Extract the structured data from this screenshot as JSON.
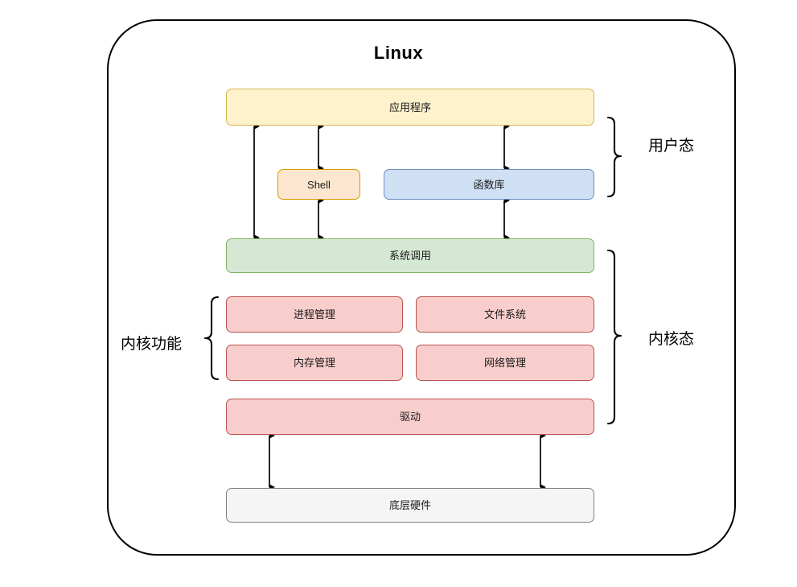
{
  "diagram": {
    "title": "Linux",
    "type": "architecture-layer-diagram"
  },
  "nodes": {
    "application": {
      "label": "应用程序",
      "fill": "#fdf2cc",
      "stroke": "#d6b656"
    },
    "shell": {
      "label": "Shell",
      "fill": "#fde6cf",
      "stroke": "#d79b00"
    },
    "libraries": {
      "label": "函数库",
      "fill": "#cfdff4",
      "stroke": "#6c8ebf"
    },
    "system_call": {
      "label": "系统调用",
      "fill": "#d5e8d4",
      "stroke": "#82b366"
    },
    "process_mgmt": {
      "label": "进程管理",
      "fill": "#f8cecc",
      "stroke": "#b85450"
    },
    "file_system": {
      "label": "文件系统",
      "fill": "#f8cecc",
      "stroke": "#b85450"
    },
    "memory_mgmt": {
      "label": "内存管理",
      "fill": "#f8cecc",
      "stroke": "#b85450"
    },
    "network_mgmt": {
      "label": "网络管理",
      "fill": "#f8cecc",
      "stroke": "#b85450"
    },
    "driver": {
      "label": "驱动",
      "fill": "#f8cecc",
      "stroke": "#b85450"
    },
    "hardware": {
      "label": "底层硬件",
      "fill": "#f5f5f5",
      "stroke": "#808080"
    }
  },
  "annotations": {
    "user_mode": "用户态",
    "kernel_mode": "内核态",
    "kernel_functions": "内核功能"
  },
  "chart_data": {
    "type": "diagram",
    "title": "Linux",
    "layers": [
      {
        "name": "应用程序",
        "tier": "用户态",
        "children": [
          "Shell",
          "函数库"
        ]
      },
      {
        "name": "系统调用",
        "tier": "boundary"
      },
      {
        "name": "内核功能",
        "tier": "内核态",
        "children": [
          "进程管理",
          "文件系统",
          "内存管理",
          "网络管理"
        ]
      },
      {
        "name": "驱动",
        "tier": "内核态"
      },
      {
        "name": "底层硬件",
        "tier": "hardware"
      }
    ],
    "connections": [
      {
        "from": "应用程序",
        "to": "系统调用",
        "kind": "bidirectional"
      },
      {
        "from": "应用程序",
        "to": "Shell",
        "kind": "bidirectional"
      },
      {
        "from": "Shell",
        "to": "系统调用",
        "kind": "bidirectional"
      },
      {
        "from": "应用程序",
        "to": "函数库",
        "kind": "bidirectional"
      },
      {
        "from": "函数库",
        "to": "系统调用",
        "kind": "bidirectional"
      },
      {
        "from": "驱动",
        "to": "底层硬件",
        "kind": "bidirectional"
      }
    ]
  }
}
